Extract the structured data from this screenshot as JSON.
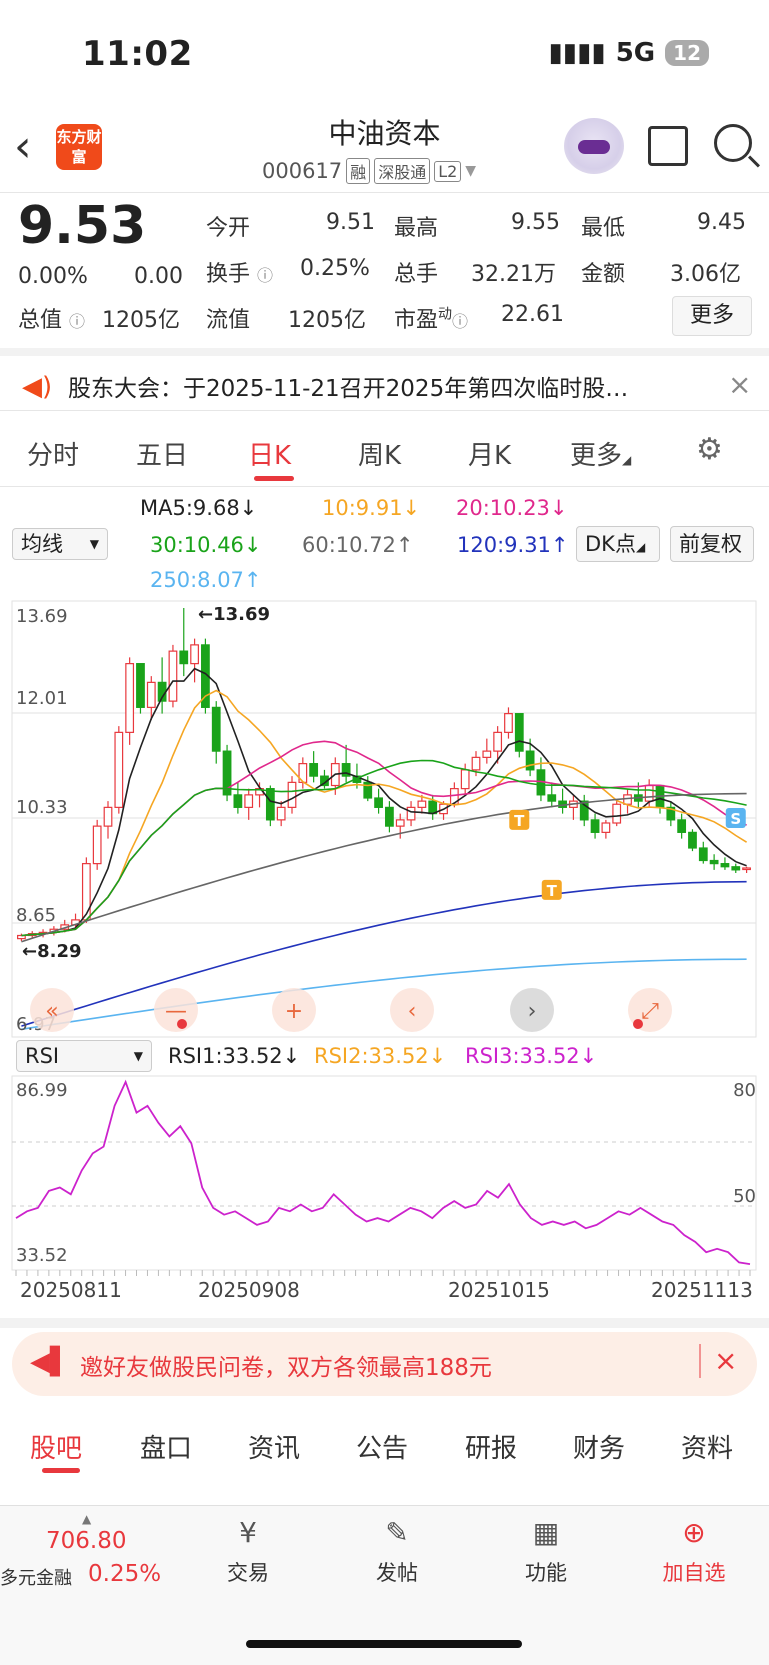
{
  "status": {
    "time": "11:02",
    "network": "5G",
    "battery": "12"
  },
  "header": {
    "logo": "东方财富",
    "title": "中油资本",
    "code": "000617",
    "tags": [
      "融",
      "深股通",
      "L2"
    ]
  },
  "quote": {
    "price": "9.53",
    "change_pct": "0.00%",
    "change": "0.00",
    "fields": [
      {
        "label": "今开",
        "value": "9.51"
      },
      {
        "label": "最高",
        "value": "9.55"
      },
      {
        "label": "最低",
        "value": "9.45"
      },
      {
        "label": "换手",
        "value": "0.25%"
      },
      {
        "label": "总手",
        "value": "32.21万"
      },
      {
        "label": "金额",
        "value": "3.06亿"
      },
      {
        "label": "总值",
        "value": "1205亿"
      },
      {
        "label": "流值",
        "value": "1205亿"
      },
      {
        "label": "市盈",
        "sup": "动",
        "value": "22.61"
      }
    ],
    "more": "更多"
  },
  "notice": {
    "text": "股东大会：于2025-11-21召开2025年第四次临时股…"
  },
  "period_tabs": [
    "分时",
    "五日",
    "日K",
    "周K",
    "月K",
    "更多"
  ],
  "active_period": "日K",
  "indicator_select": "均线",
  "ma_legend": [
    {
      "text": "MA5:9.68↓",
      "color": "#222222"
    },
    {
      "text": "10:9.91↓",
      "color": "#f5a623"
    },
    {
      "text": "20:10.23↓",
      "color": "#e0288c"
    },
    {
      "text": "30:10.46↓",
      "color": "#1aa31a"
    },
    {
      "text": "60:10.72↑",
      "color": "#666666"
    },
    {
      "text": "120:9.31↑",
      "color": "#2233bb"
    },
    {
      "text": "250:8.07↑",
      "color": "#5ab4f0"
    }
  ],
  "dk_button": "DK点",
  "adjust_button": "前复权",
  "chart_data": {
    "type": "candlestick",
    "price_axis": {
      "max_label": "13.69",
      "mid_labels": [
        "12.01",
        "10.33",
        "8.65"
      ],
      "min_label": "6.97"
    },
    "annotations": {
      "high": "←13.69",
      "low": "←8.29"
    },
    "candles": [
      [
        8.4,
        8.48,
        8.36,
        8.45
      ],
      [
        8.45,
        8.52,
        8.4,
        8.48
      ],
      [
        8.48,
        8.55,
        8.42,
        8.5
      ],
      [
        8.5,
        8.6,
        8.45,
        8.55
      ],
      [
        8.55,
        8.7,
        8.5,
        8.62
      ],
      [
        8.62,
        8.8,
        8.55,
        8.7
      ],
      [
        8.7,
        9.7,
        8.65,
        9.6
      ],
      [
        9.6,
        10.3,
        9.5,
        10.2
      ],
      [
        10.2,
        10.6,
        10.0,
        10.5
      ],
      [
        10.5,
        11.8,
        10.4,
        11.7
      ],
      [
        11.7,
        12.9,
        11.5,
        12.8
      ],
      [
        12.8,
        12.7,
        12.0,
        12.1
      ],
      [
        12.1,
        12.6,
        11.9,
        12.5
      ],
      [
        12.5,
        12.9,
        12.0,
        12.2
      ],
      [
        12.2,
        13.1,
        12.1,
        13.0
      ],
      [
        13.0,
        13.69,
        12.6,
        12.8
      ],
      [
        12.8,
        13.2,
        12.5,
        13.1
      ],
      [
        13.1,
        13.2,
        12.0,
        12.1
      ],
      [
        12.1,
        12.2,
        11.2,
        11.4
      ],
      [
        11.4,
        11.5,
        10.6,
        10.7
      ],
      [
        10.7,
        10.9,
        10.4,
        10.5
      ],
      [
        10.5,
        10.8,
        10.3,
        10.7
      ],
      [
        10.7,
        10.9,
        10.5,
        10.8
      ],
      [
        10.8,
        10.85,
        10.2,
        10.3
      ],
      [
        10.3,
        10.6,
        10.2,
        10.5
      ],
      [
        10.5,
        11.0,
        10.4,
        10.9
      ],
      [
        10.9,
        11.3,
        10.8,
        11.2
      ],
      [
        11.2,
        11.4,
        10.9,
        11.0
      ],
      [
        11.0,
        11.1,
        10.8,
        10.85
      ],
      [
        10.85,
        11.3,
        10.7,
        11.2
      ],
      [
        11.2,
        11.5,
        10.9,
        11.0
      ],
      [
        11.0,
        11.2,
        10.8,
        10.9
      ],
      [
        10.9,
        11.0,
        10.6,
        10.65
      ],
      [
        10.65,
        10.8,
        10.4,
        10.5
      ],
      [
        10.5,
        10.6,
        10.1,
        10.2
      ],
      [
        10.2,
        10.4,
        10.0,
        10.3
      ],
      [
        10.3,
        10.6,
        10.2,
        10.5
      ],
      [
        10.5,
        10.7,
        10.4,
        10.6
      ],
      [
        10.6,
        10.7,
        10.3,
        10.4
      ],
      [
        10.4,
        10.6,
        10.3,
        10.55
      ],
      [
        10.55,
        10.9,
        10.5,
        10.8
      ],
      [
        10.8,
        11.2,
        10.7,
        11.1
      ],
      [
        11.1,
        11.4,
        11.0,
        11.3
      ],
      [
        11.3,
        11.6,
        11.2,
        11.4
      ],
      [
        11.4,
        11.8,
        11.2,
        11.7
      ],
      [
        11.7,
        12.1,
        11.6,
        12.0
      ],
      [
        12.0,
        11.9,
        11.3,
        11.4
      ],
      [
        11.4,
        11.6,
        11.0,
        11.1
      ],
      [
        11.1,
        11.3,
        10.6,
        10.7
      ],
      [
        10.7,
        10.9,
        10.5,
        10.6
      ],
      [
        10.6,
        10.8,
        10.4,
        10.5
      ],
      [
        10.5,
        10.7,
        10.3,
        10.6
      ],
      [
        10.6,
        10.7,
        10.2,
        10.3
      ],
      [
        10.3,
        10.4,
        10.0,
        10.1
      ],
      [
        10.1,
        10.3,
        10.0,
        10.25
      ],
      [
        10.25,
        10.6,
        10.2,
        10.55
      ],
      [
        10.55,
        10.8,
        10.4,
        10.7
      ],
      [
        10.7,
        10.9,
        10.5,
        10.6
      ],
      [
        10.6,
        10.95,
        10.5,
        10.85
      ],
      [
        10.85,
        10.8,
        10.4,
        10.5
      ],
      [
        10.5,
        10.6,
        10.2,
        10.3
      ],
      [
        10.3,
        10.4,
        10.0,
        10.1
      ],
      [
        10.1,
        10.15,
        9.8,
        9.85
      ],
      [
        9.85,
        9.95,
        9.6,
        9.65
      ],
      [
        9.65,
        9.75,
        9.5,
        9.6
      ],
      [
        9.6,
        9.7,
        9.5,
        9.55
      ],
      [
        9.55,
        9.6,
        9.45,
        9.5
      ],
      [
        9.51,
        9.55,
        9.45,
        9.53
      ]
    ],
    "rsi": {
      "select": "RSI",
      "legend": [
        {
          "text": "RSI1:33.52↓",
          "color": "#222222"
        },
        {
          "text": "RSI2:33.52↓",
          "color": "#f5a623"
        },
        {
          "text": "RSI3:33.52↓",
          "color": "#cc22cc"
        }
      ],
      "max_label": "86.99",
      "min_label": "33.52",
      "right_labels": [
        "80",
        "50"
      ],
      "values": [
        47,
        49,
        50,
        55,
        56,
        54,
        61,
        66,
        68,
        80,
        87,
        78,
        80,
        75,
        71,
        74,
        69,
        56,
        50,
        48,
        49,
        47,
        45,
        46,
        50,
        49,
        51,
        49,
        50,
        54,
        51,
        48,
        46,
        47,
        46,
        48,
        50,
        49,
        47,
        50,
        52,
        50,
        51,
        55,
        53,
        57,
        51,
        47,
        45,
        46,
        45,
        46,
        44,
        45,
        47,
        49,
        48,
        50,
        48,
        46,
        45,
        42,
        40,
        37,
        38,
        37,
        34,
        33.5
      ]
    },
    "dates": [
      "20250811",
      "20250908",
      "20251015",
      "20251113"
    ]
  },
  "chart_controls": [
    "«",
    "—",
    "+",
    "‹",
    "›",
    "⤢"
  ],
  "markers": {
    "s": "S",
    "t": "T"
  },
  "banner": {
    "text": "邀好友做股民问卷，双方各领最高188元"
  },
  "bottom_tabs": [
    "股吧",
    "盘口",
    "资讯",
    "公告",
    "研报",
    "财务",
    "资料"
  ],
  "bottom_nav": {
    "index_value": "706.80",
    "index_name": "多元金融",
    "index_change": "0.25%",
    "items": [
      "交易",
      "发帖",
      "功能",
      "加自选"
    ]
  }
}
